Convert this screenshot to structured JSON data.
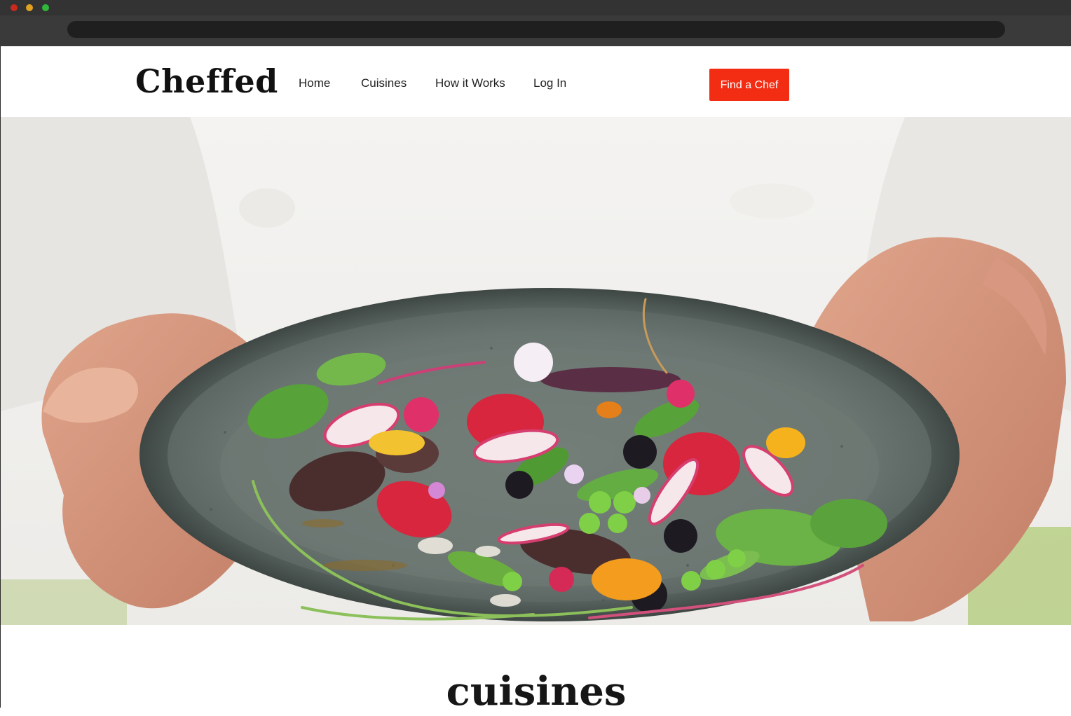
{
  "header": {
    "logo": "Cheffed",
    "nav": {
      "home": "Home",
      "cuisines": "Cuisines",
      "how_it_works": "How it Works",
      "login": "Log In"
    },
    "cta_label": "Find a Chef"
  },
  "hero": {
    "image_description": "chef-hands-holding-plate-of-salad"
  },
  "section": {
    "title": "cuisines"
  },
  "colors": {
    "accent": "#f32d13",
    "text": "#222222",
    "chrome": "#3a3a3a"
  }
}
